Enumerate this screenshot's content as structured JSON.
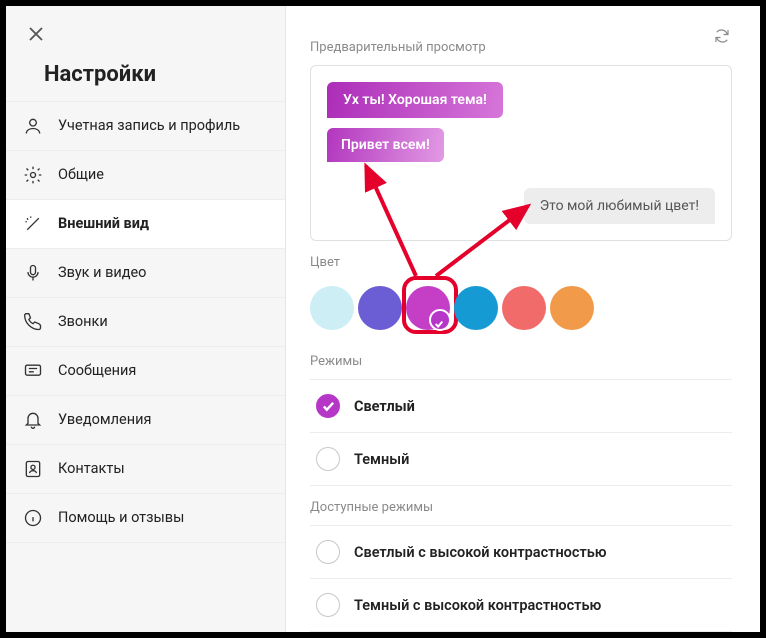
{
  "sidebar": {
    "title": "Настройки",
    "items": [
      {
        "id": "account",
        "label": "Учетная запись и профиль",
        "icon": "user"
      },
      {
        "id": "general",
        "label": "Общие",
        "icon": "gear"
      },
      {
        "id": "appearance",
        "label": "Внешний вид",
        "icon": "wand",
        "active": true
      },
      {
        "id": "av",
        "label": "Звук и видео",
        "icon": "mic"
      },
      {
        "id": "calls",
        "label": "Звонки",
        "icon": "phone"
      },
      {
        "id": "messages",
        "label": "Сообщения",
        "icon": "chat"
      },
      {
        "id": "notify",
        "label": "Уведомления",
        "icon": "bell"
      },
      {
        "id": "contacts",
        "label": "Контакты",
        "icon": "contacts"
      },
      {
        "id": "help",
        "label": "Помощь и отзывы",
        "icon": "info"
      }
    ]
  },
  "preview": {
    "label": "Предварительный просмотр",
    "msg_out_1": "Ух ты! Хорошая тема!",
    "msg_out_2": "Привет всем!",
    "msg_in_1": "Это мой любимый цвет!"
  },
  "color": {
    "label": "Цвет",
    "swatches": [
      {
        "id": "teal-light",
        "hex": "#cdeef4"
      },
      {
        "id": "indigo",
        "hex": "#6b5dd3"
      },
      {
        "id": "magenta",
        "hex": "#c43fc6",
        "selected": true
      },
      {
        "id": "blue",
        "hex": "#159ad4"
      },
      {
        "id": "coral",
        "hex": "#f16b6b"
      },
      {
        "id": "orange",
        "hex": "#f19a4a"
      }
    ]
  },
  "modes": {
    "label": "Режимы",
    "options": [
      {
        "id": "light",
        "label": "Светлый",
        "selected": true
      },
      {
        "id": "dark",
        "label": "Темный"
      }
    ]
  },
  "accessible_modes": {
    "label": "Доступные режимы",
    "options": [
      {
        "id": "light-hc",
        "label": "Светлый с высокой контрастностью"
      },
      {
        "id": "dark-hc",
        "label": "Темный с высокой контрастностью"
      }
    ]
  }
}
